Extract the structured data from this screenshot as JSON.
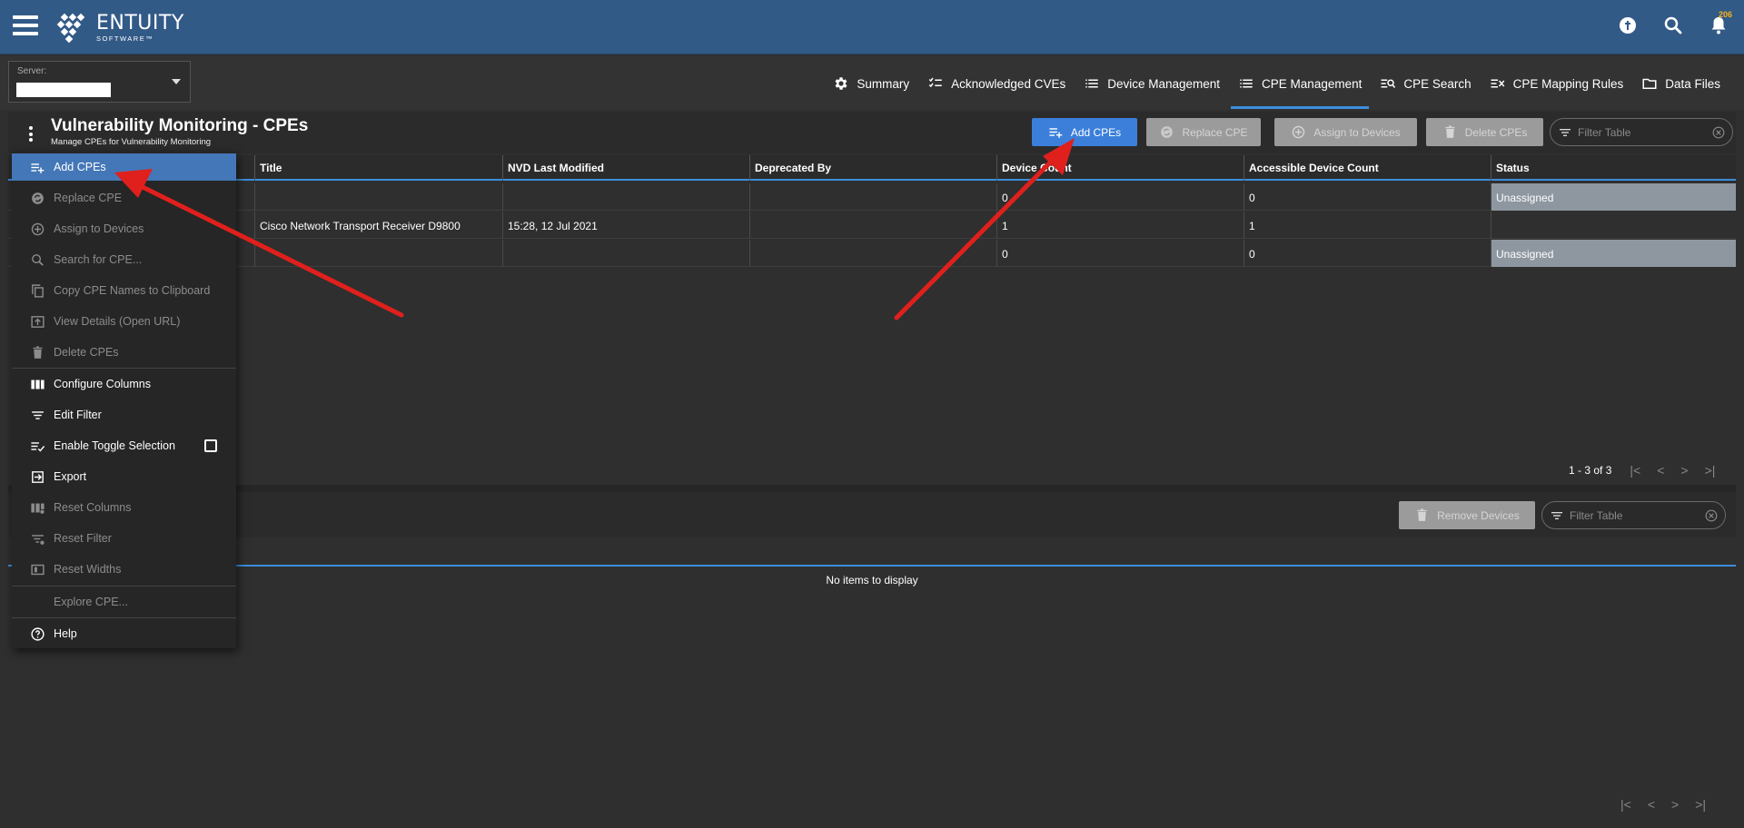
{
  "brand": {
    "name": "ENTUITY",
    "tagline": "SOFTWARE™"
  },
  "notifications": {
    "count": "206"
  },
  "server": {
    "label": "Server:",
    "value": ""
  },
  "nav": {
    "tabs": [
      {
        "label": "Summary",
        "icon": "gear-icon"
      },
      {
        "label": "Acknowledged CVEs",
        "icon": "checklist-icon"
      },
      {
        "label": "Device Management",
        "icon": "list-icon"
      },
      {
        "label": "CPE Management",
        "icon": "list-icon"
      },
      {
        "label": "CPE Search",
        "icon": "list-search-icon"
      },
      {
        "label": "CPE Mapping Rules",
        "icon": "list-rule-icon"
      },
      {
        "label": "Data Files",
        "icon": "folder-icon"
      }
    ],
    "active": "CPE Management"
  },
  "page": {
    "title": "Vulnerability Monitoring - CPEs",
    "subtitle": "Manage CPEs for Vulnerability Monitoring"
  },
  "toolbar": {
    "add_label": "Add CPEs",
    "replace_label": "Replace CPE",
    "assign_label": "Assign to Devices",
    "delete_label": "Delete CPEs",
    "filter_placeholder": "Filter Table"
  },
  "table": {
    "columns": [
      "Title",
      "NVD Last Modified",
      "Deprecated By",
      "Device Count",
      "Accessible Device Count",
      "Status"
    ],
    "rows": [
      {
        "title": "",
        "modified": "",
        "deprecated": "",
        "device_count": "0",
        "accessible": "0",
        "status": "Unassigned"
      },
      {
        "title": "Cisco Network Transport Receiver D9800",
        "modified": "15:28, 12 Jul 2021",
        "deprecated": "",
        "device_count": "1",
        "accessible": "1",
        "status": ""
      },
      {
        "title": "",
        "modified": "",
        "deprecated": "",
        "device_count": "0",
        "accessible": "0",
        "status": "Unassigned"
      }
    ],
    "pager": "1 - 3 of 3"
  },
  "devices_panel": {
    "remove_label": "Remove Devices",
    "filter_placeholder": "Filter Table",
    "empty": "No items to display"
  },
  "menu": {
    "items": [
      {
        "label": "Add CPEs",
        "icon": "add-list-icon",
        "state": "highlight"
      },
      {
        "label": "Replace CPE",
        "icon": "replace-icon",
        "state": "disabled"
      },
      {
        "label": "Assign to Devices",
        "icon": "plus-circle-icon",
        "state": "disabled"
      },
      {
        "label": "Search for CPE...",
        "icon": "search-icon",
        "state": "disabled"
      },
      {
        "label": "Copy CPE Names to Clipboard",
        "icon": "copy-icon",
        "state": "disabled"
      },
      {
        "label": "View Details (Open URL)",
        "icon": "open-url-icon",
        "state": "disabled"
      },
      {
        "label": "Delete CPEs",
        "icon": "trash-icon",
        "state": "disabled"
      },
      {
        "label": "Configure Columns",
        "icon": "columns-icon",
        "state": "normal"
      },
      {
        "label": "Edit Filter",
        "icon": "filter-icon",
        "state": "normal"
      },
      {
        "label": "Enable Toggle Selection",
        "icon": "toggle-select-icon",
        "state": "normal"
      },
      {
        "label": "Export",
        "icon": "export-icon",
        "state": "normal"
      },
      {
        "label": "Reset Columns",
        "icon": "reset-columns-icon",
        "state": "disabled"
      },
      {
        "label": "Reset Filter",
        "icon": "reset-filter-icon",
        "state": "disabled"
      },
      {
        "label": "Reset Widths",
        "icon": "reset-widths-icon",
        "state": "disabled"
      },
      {
        "label": "Explore CPE...",
        "icon": "",
        "state": "disabled"
      },
      {
        "label": "Help",
        "icon": "help-icon",
        "state": "normal"
      }
    ]
  },
  "colors": {
    "header": "#325a87",
    "accent": "#3c8edb",
    "primary_button": "#3b7fdb",
    "annotation_arrow": "#e0201c"
  }
}
